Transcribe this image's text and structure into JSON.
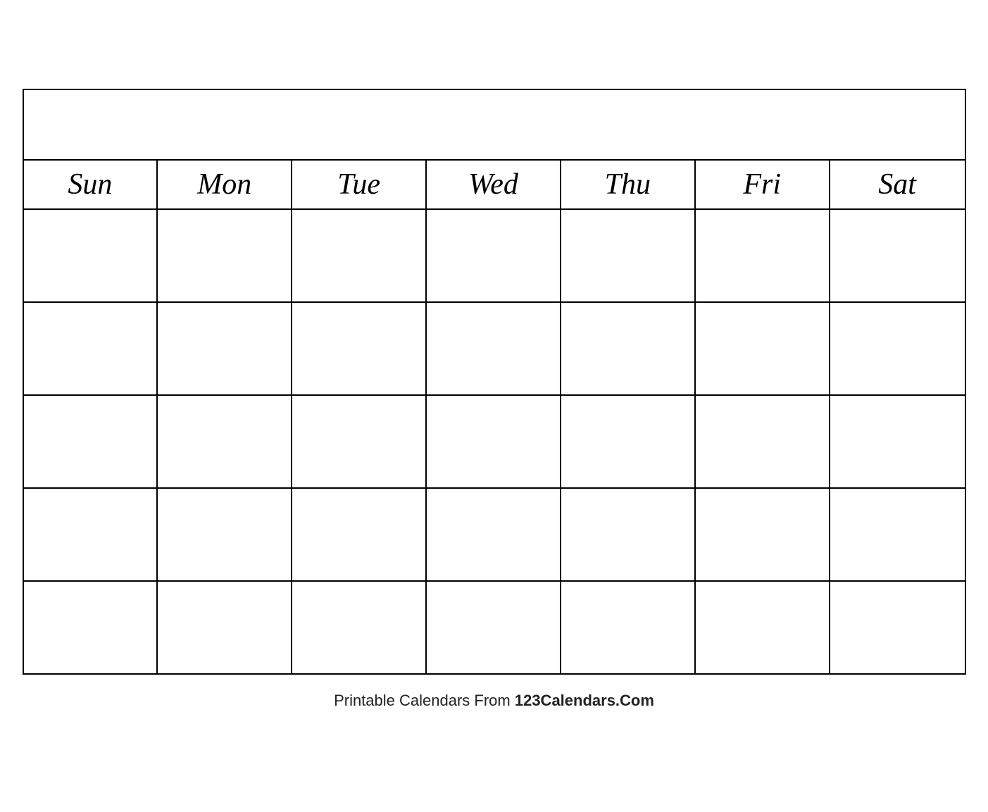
{
  "calendar": {
    "title": "",
    "days": [
      "Sun",
      "Mon",
      "Tue",
      "Wed",
      "Thu",
      "Fri",
      "Sat"
    ],
    "rows": 5
  },
  "footer": {
    "text_regular": "Printable Calendars From ",
    "text_bold": "123Calendars.Com"
  }
}
